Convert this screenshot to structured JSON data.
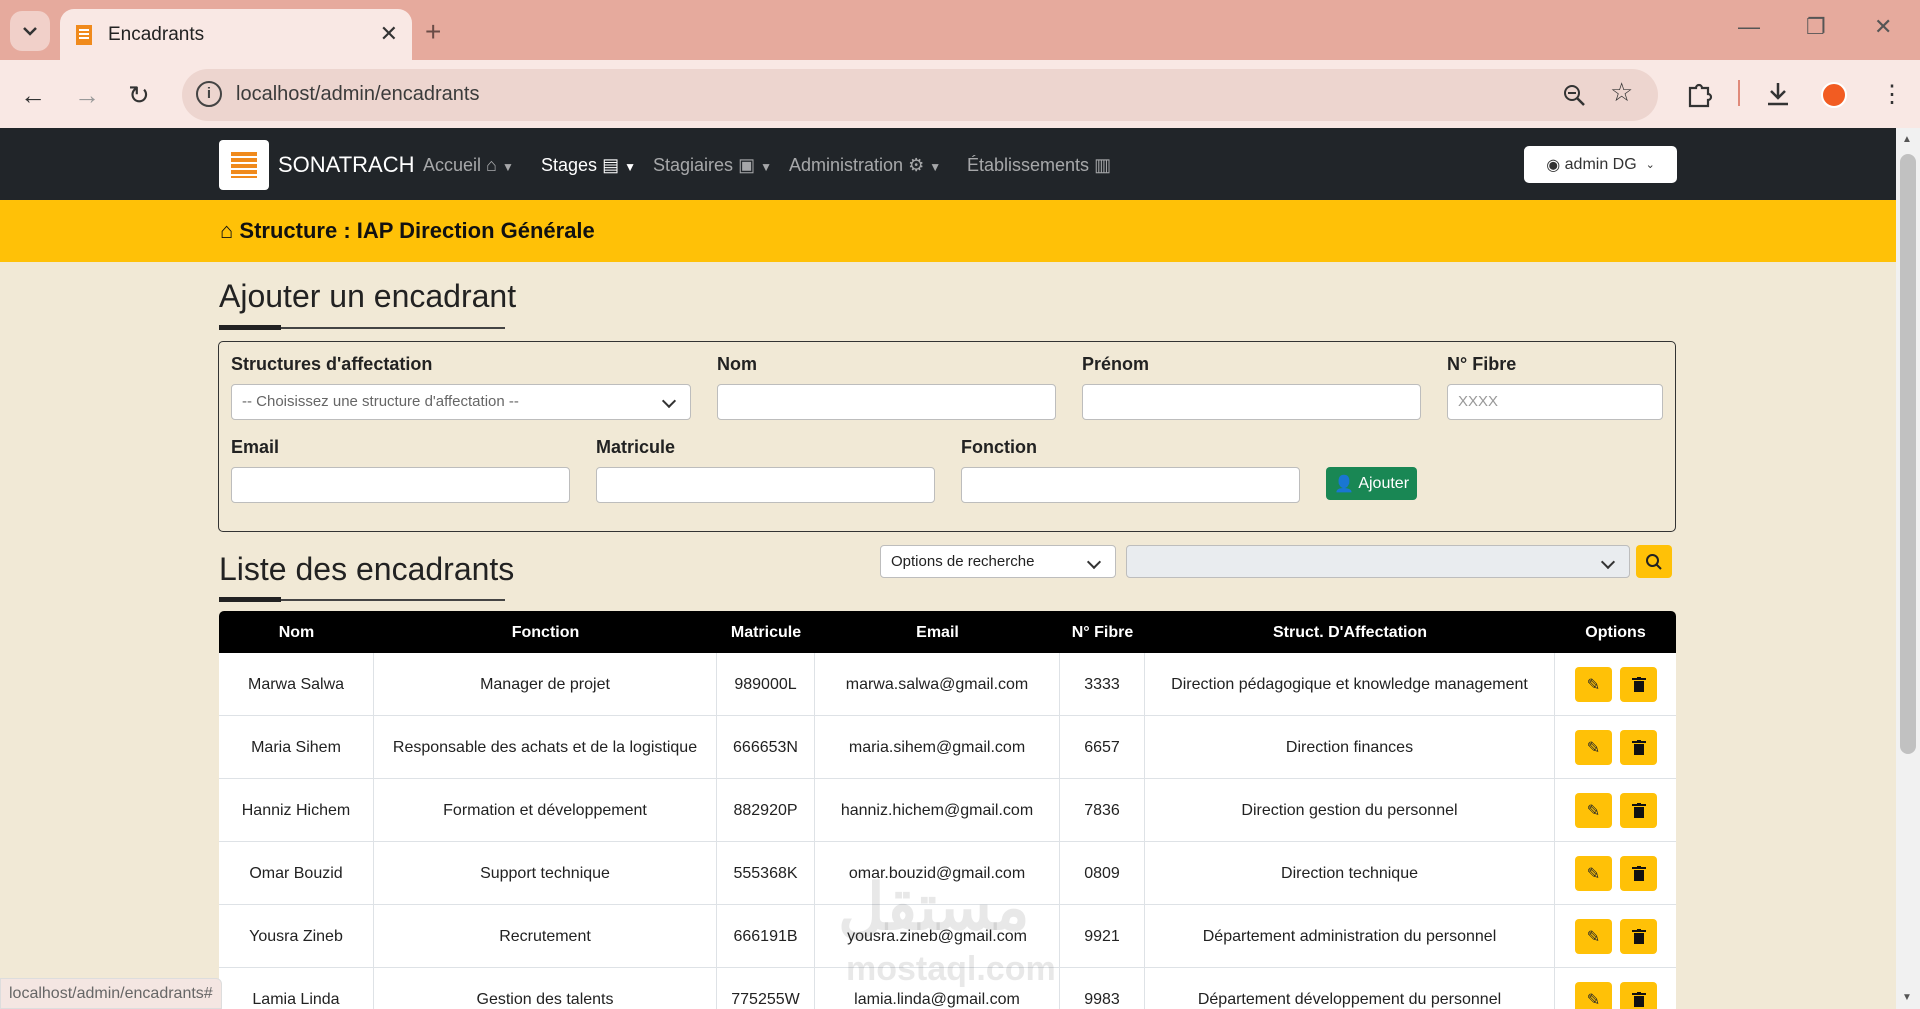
{
  "browser": {
    "tab_title": "Encadrants",
    "new_tab_symbol": "+",
    "url": "localhost/admin/encadrants",
    "status_url": "localhost/admin/encadrants#"
  },
  "nav": {
    "brand": "SONATRACH",
    "items": [
      {
        "label": "Accueil",
        "icon": "home-icon"
      },
      {
        "label": "Stages",
        "icon": "list-icon"
      },
      {
        "label": "Stagiaires",
        "icon": "id-card-icon"
      },
      {
        "label": "Administration",
        "icon": "gear-icon"
      },
      {
        "label": "Établissements",
        "icon": "building-icon"
      }
    ],
    "user": "admin DG"
  },
  "banner": {
    "text": "Structure : IAP Direction Générale"
  },
  "form": {
    "title": "Ajouter un encadrant",
    "labels": {
      "structure": "Structures d'affectation",
      "nom": "Nom",
      "prenom": "Prénom",
      "fibre": "N° Fibre",
      "email": "Email",
      "matricule": "Matricule",
      "fonction": "Fonction"
    },
    "structure_value": "-- Choisissez une structure d'affectation --",
    "fibre_placeholder": "XXXX",
    "add_label": "Ajouter"
  },
  "list": {
    "title": "Liste des encadrants",
    "search_options": "Options de recherche",
    "columns": [
      "Nom",
      "Fonction",
      "Matricule",
      "Email",
      "N° Fibre",
      "Struct. D'Affectation",
      "Options"
    ],
    "rows": [
      [
        "Marwa Salwa",
        "Manager de projet",
        "989000L",
        "marwa.salwa@gmail.com",
        "3333",
        "Direction pédagogique et knowledge management"
      ],
      [
        "Maria Sihem",
        "Responsable des achats et de la logistique",
        "666653N",
        "maria.sihem@gmail.com",
        "6657",
        "Direction finances"
      ],
      [
        "Hanniz Hichem",
        "Formation et développement",
        "882920P",
        "hanniz.hichem@gmail.com",
        "7836",
        "Direction gestion du personnel"
      ],
      [
        "Omar Bouzid",
        "Support technique",
        "555368K",
        "omar.bouzid@gmail.com",
        "0809",
        "Direction technique"
      ],
      [
        "Yousra Zineb",
        "Recrutement",
        "666191B",
        "yousra.zineb@gmail.com",
        "9921",
        "Département administration du personnel"
      ],
      [
        "Lamia Linda",
        "Gestion des talents",
        "775255W",
        "lamia.linda@gmail.com",
        "9983",
        "Département développement du personnel"
      ]
    ]
  },
  "watermark": {
    "arabic": "مستقل",
    "latin": "mostaql.com"
  }
}
